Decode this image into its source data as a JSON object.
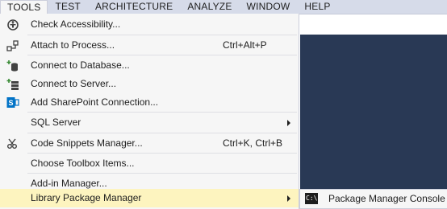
{
  "menubar": {
    "items": [
      "TOOLS",
      "TEST",
      "ARCHITECTURE",
      "ANALYZE",
      "WINDOW",
      "HELP"
    ]
  },
  "tools_menu": {
    "items": [
      {
        "label": "Check Accessibility...",
        "shortcut": "",
        "icon": "accessibility-icon"
      },
      {
        "label": "Attach to Process...",
        "shortcut": "Ctrl+Alt+P",
        "icon": "attach-process-icon"
      },
      {
        "label": "Connect to Database...",
        "shortcut": "",
        "icon": "connect-database-icon"
      },
      {
        "label": "Connect to Server...",
        "shortcut": "",
        "icon": "connect-server-icon"
      },
      {
        "label": "Add SharePoint Connection...",
        "shortcut": "",
        "icon": "sharepoint-icon"
      },
      {
        "label": "SQL Server",
        "shortcut": "",
        "icon": ""
      },
      {
        "label": "Code Snippets Manager...",
        "shortcut": "Ctrl+K, Ctrl+B",
        "icon": "code-snippets-icon"
      },
      {
        "label": "Choose Toolbox Items...",
        "shortcut": "",
        "icon": ""
      },
      {
        "label": "Add-in Manager...",
        "shortcut": "",
        "icon": ""
      },
      {
        "label": "Library Package Manager",
        "shortcut": "",
        "icon": ""
      }
    ]
  },
  "submenu": {
    "items": [
      {
        "label": "Package Manager Console",
        "icon": "console-icon",
        "icon_text": "C:\\"
      }
    ]
  },
  "colors": {
    "menu_bg": "#f6f6f6",
    "highlight": "#fdf4bf",
    "menubar_bg": "#d6dbe9",
    "editor_dark": "#293955"
  }
}
